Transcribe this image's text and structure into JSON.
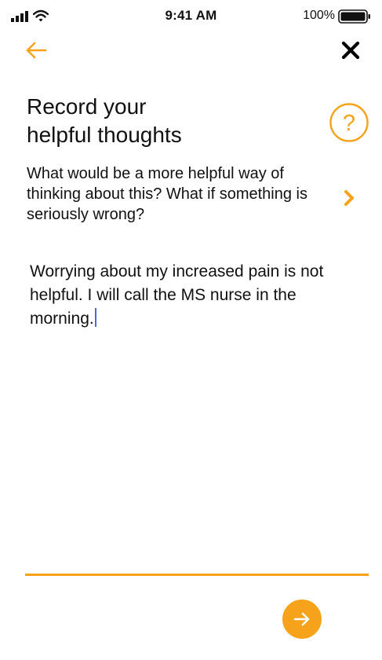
{
  "status_bar": {
    "time": "9:41 AM",
    "battery_percent": "100%",
    "signal_icon": "cellular-signal-icon",
    "wifi_icon": "wifi-icon",
    "battery_icon": "battery-icon"
  },
  "nav": {
    "back_icon": "arrow-left-icon",
    "close_icon": "close-icon"
  },
  "page": {
    "title_line1": "Record your",
    "title_line2": "helpful thoughts",
    "help_icon": "question-circle-icon",
    "prompt": "What would be a more helpful way of thinking about this? What if something is seriously wrong?",
    "next_prompt_icon": "chevron-right-icon"
  },
  "entry": {
    "value": "Worrying about my increased pain is not helpful. I will call the MS nurse in the morning."
  },
  "footer": {
    "submit_icon": "arrow-right-icon"
  },
  "colors": {
    "accent": "#f7a21b",
    "text": "#111111",
    "caret": "#4a6bd6",
    "background": "#ffffff"
  }
}
